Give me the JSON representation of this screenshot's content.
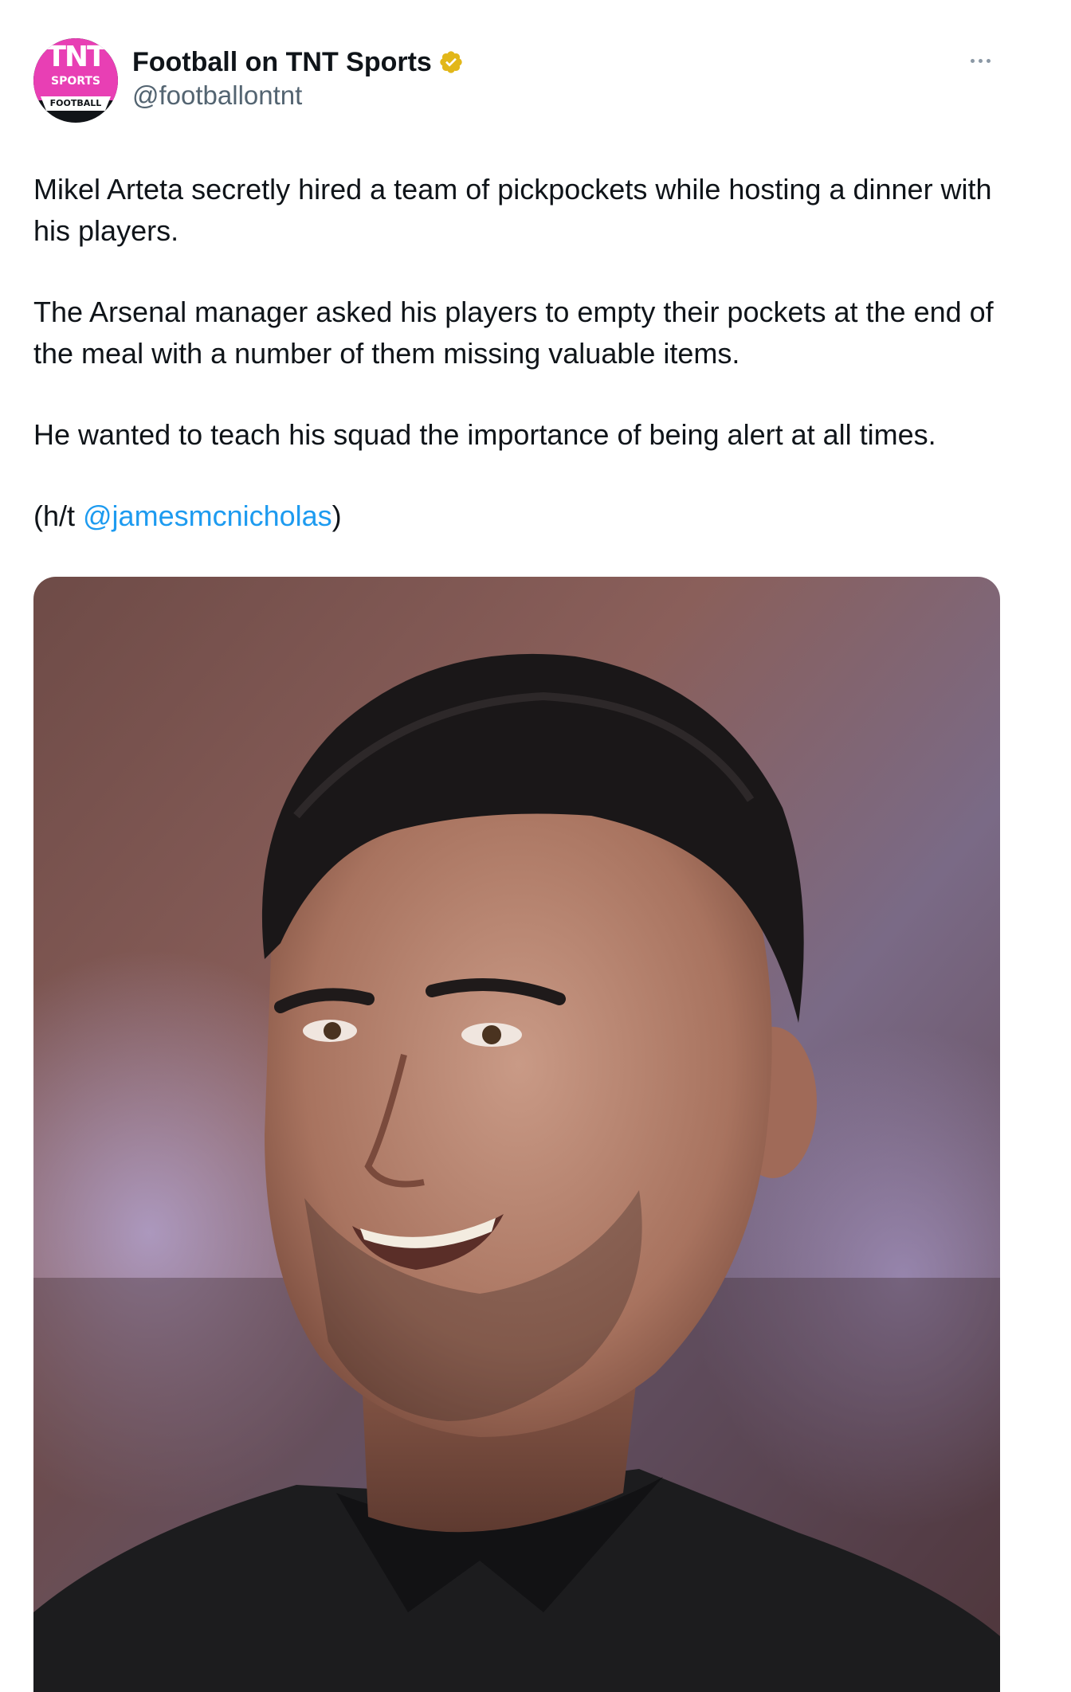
{
  "author": {
    "display_name": "Football on TNT Sports",
    "handle": "@footballontnt",
    "verified": true,
    "avatar": {
      "line1": "TNT",
      "line2": "SPORTS",
      "line3": "FOOTBALL",
      "brand_color": "#e83fb4"
    }
  },
  "tweet": {
    "paragraphs": [
      "Mikel Arteta secretly hired a team of pickpockets while hosting a dinner with his players.",
      "The Arsenal manager asked his players to empty their pockets at the end of the meal with a number of them missing valuable items.",
      "He wanted to teach his squad the importance of being alert at all times."
    ],
    "credit_prefix": "(h/t ",
    "credit_mention": "@jamesmcnicholas",
    "credit_suffix": ")"
  },
  "colors": {
    "text": "#0f1419",
    "secondary": "#536471",
    "link": "#1d9bf0",
    "verified_badge": "#e2b719"
  },
  "icons": {
    "verified": "verified-badge-icon",
    "more": "more-options-icon"
  }
}
